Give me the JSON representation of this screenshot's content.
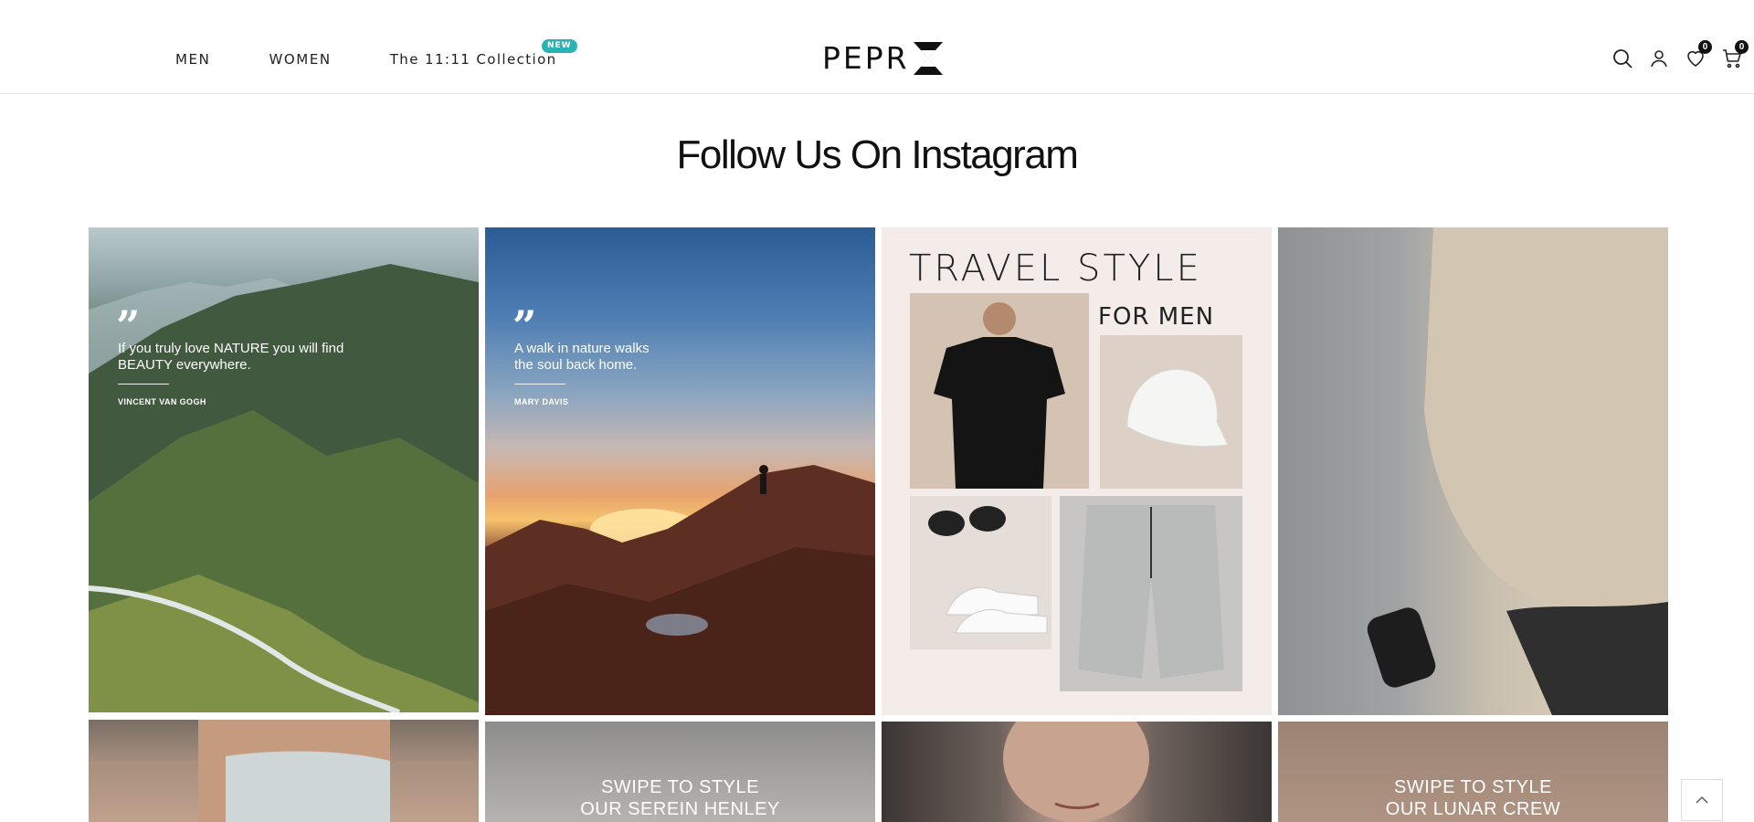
{
  "header": {
    "nav": [
      {
        "label": "MEN"
      },
      {
        "label": "WOMEN"
      },
      {
        "label": "The 11:11 Collection",
        "badge": "NEW"
      }
    ],
    "logo": "PEPR",
    "icons": [
      "search-icon",
      "account-icon",
      "wishlist-icon",
      "cart-icon"
    ],
    "wishlist_count": "0",
    "cart_count": "0"
  },
  "section": {
    "title": "Follow Us On Instagram"
  },
  "posts": [
    {
      "quote": "If you truly love NATURE you will find BEAUTY everywhere.",
      "author": "VINCENT VAN GOGH"
    },
    {
      "quote": "A walk in nature walks the soul back home.",
      "author": "MARY DAVIS"
    },
    {
      "title": "TRAVEL STYLE",
      "subtitle": "FOR MEN"
    },
    {},
    {},
    {
      "line1": "SWIPE TO STYLE",
      "line2": "OUR SEREIN HENLEY"
    },
    {},
    {
      "line1": "SWIPE TO STYLE",
      "line2": "OUR LUNAR CREW"
    }
  ],
  "colors": {
    "badge": "#29b4b4",
    "text": "#111111"
  }
}
